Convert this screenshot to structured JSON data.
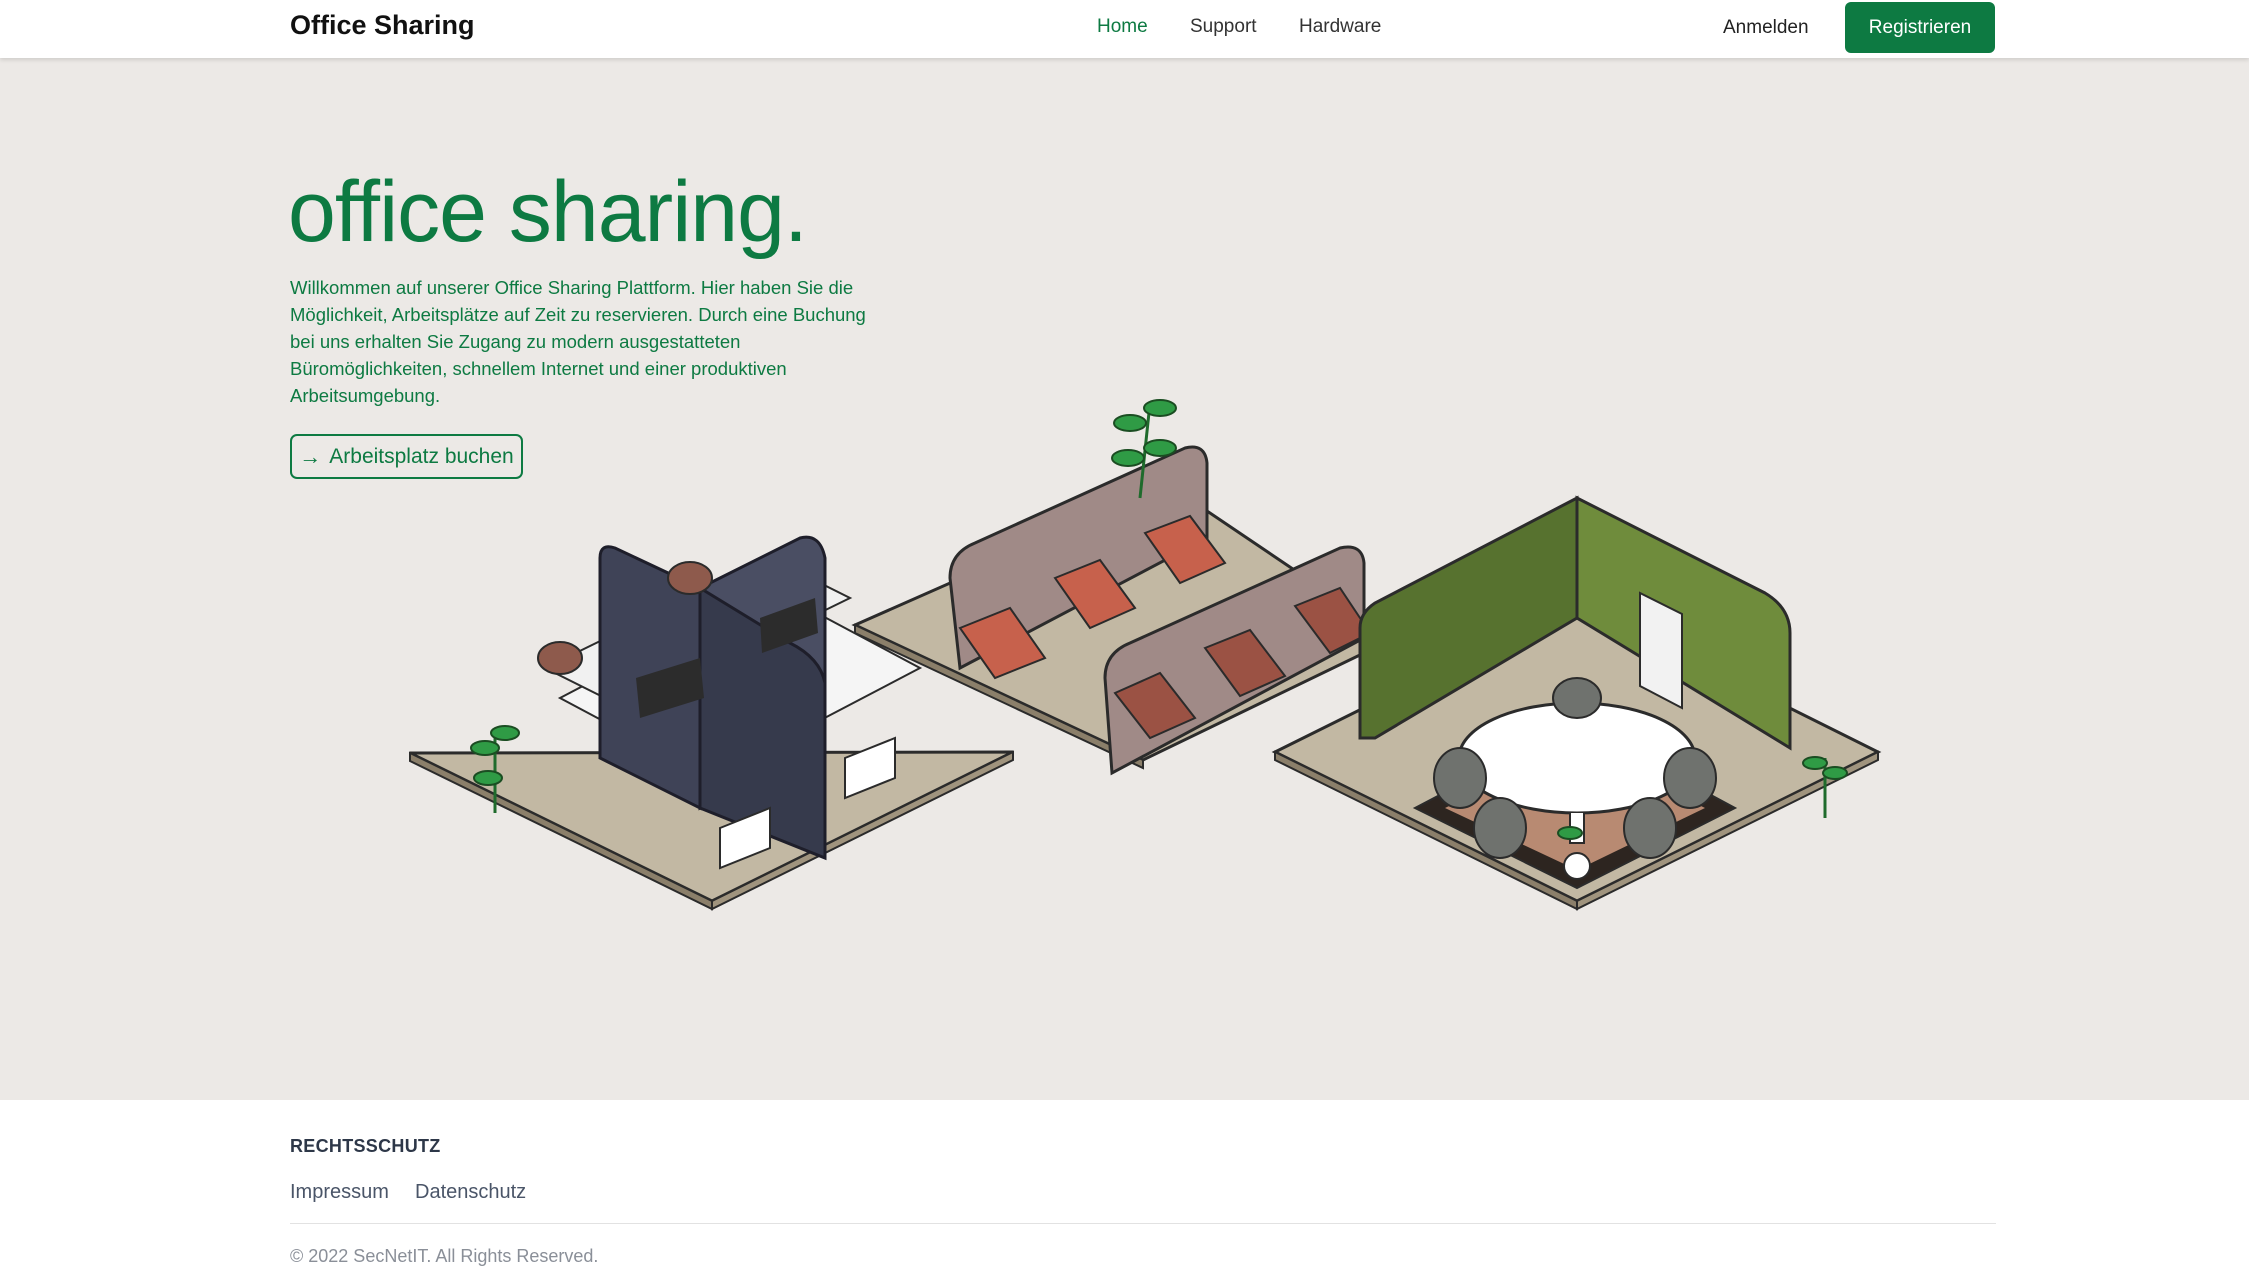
{
  "header": {
    "brand": "Office Sharing",
    "nav": [
      {
        "label": "Home",
        "active": true
      },
      {
        "label": "Support",
        "active": false
      },
      {
        "label": "Hardware",
        "active": false
      }
    ],
    "login_label": "Anmelden",
    "register_label": "Registrieren"
  },
  "hero": {
    "title": "office sharing.",
    "text": "Willkommen auf unserer Office Sharing Plattform. Hier haben Sie die Möglichkeit, Arbeitsplätze auf Zeit zu reservieren. Durch eine Buchung bei uns erhalten Sie Zugang zu modern ausgestatteten Büromöglichkeiten, schnellem Internet und einer produktiven Arbeitsumgebung.",
    "cta_label": "Arbeitsplatz buchen",
    "cta_icon": "arrow-right-icon"
  },
  "footer": {
    "heading": "RECHTSSCHUTZ",
    "links": [
      "Impressum",
      "Datenschutz"
    ],
    "copyright": "© 2022 SecNetIT. All Rights Reserved."
  },
  "colors": {
    "accent": "#0d7a42",
    "hero_bg": "#ece9e6",
    "floor": "#c2b8a3",
    "desk_partition": "#3f4357",
    "lounge_partition": "#a08a87",
    "chair_red": "#c7614c",
    "meeting_wall": "#6b8a3a"
  }
}
